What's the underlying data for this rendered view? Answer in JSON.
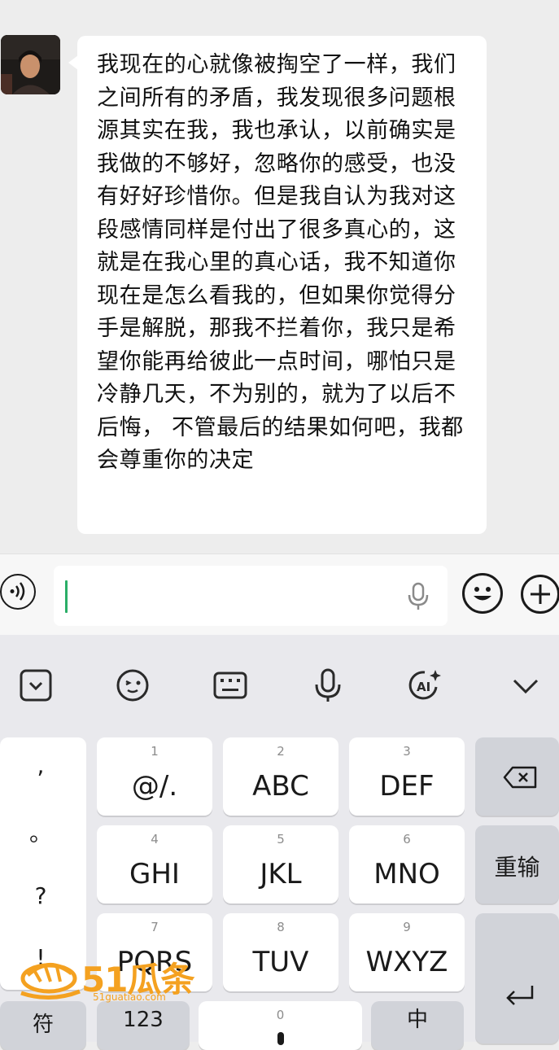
{
  "chat": {
    "message": "我现在的心就像被掏空了一样，我们之间所有的矛盾，我发现很多问题根源其实在我，我也承认，以前确实是我做的不够好，忽略你的感受，也没有好好珍惜你。但是我自认为我对这段感情同样是付出了很多真心的，这就是在我心里的真心话，我不知道你现在是怎么看我的，但如果你觉得分手是解脱，那我不拦着你，我只是希望你能再给彼此一点时间，哪怕只是冷静几天，不为别的，就为了以后不后悔， 不管最后的结果如何吧，我都会尊重你的决定"
  },
  "input": {
    "value": "",
    "placeholder": ""
  },
  "keyboard": {
    "punct": [
      ",",
      "。",
      "?",
      "!"
    ],
    "keys": [
      {
        "num": "1",
        "label": "@/."
      },
      {
        "num": "2",
        "label": "ABC"
      },
      {
        "num": "3",
        "label": "DEF"
      },
      {
        "num": "4",
        "label": "GHI"
      },
      {
        "num": "5",
        "label": "JKL"
      },
      {
        "num": "6",
        "label": "MNO"
      },
      {
        "num": "7",
        "label": "PQRS"
      },
      {
        "num": "8",
        "label": "TUV"
      },
      {
        "num": "9",
        "label": "WXYZ"
      }
    ],
    "retype_label": "重输",
    "bottom": {
      "symbols": "符",
      "numbers": "123",
      "space_num": "0",
      "lang": "中"
    }
  },
  "watermark": {
    "brand": "51瓜条",
    "url": "51guatiao.com"
  },
  "colors": {
    "accent": "#2aae67",
    "watermark": "#f4a120"
  }
}
